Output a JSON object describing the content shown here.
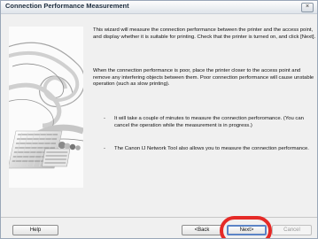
{
  "window": {
    "title": "Connection Performance Measurement",
    "close_label": "×"
  },
  "body": {
    "p1": "This wizard will measure the connection performance between the printer and the access point, and display whether it is suitable for printing. Check that the printer is turned on, and click [Next].",
    "p2": "When the connection performance is poor, place the printer closer to the access point and remove any interfering objects between them. Poor connection performance will cause unstable operation (such as slow printing).",
    "bullet": "-",
    "b1": "It will take a couple of minutes to measure the connection perforomance. (You can cancel the operation while the measurement is in progress.)",
    "b2": "The Canon IJ Network Tool also allows you to measure the connection performance."
  },
  "buttons": {
    "help": "Help",
    "back": "<Back",
    "next": "Next>",
    "cancel": "Cancel"
  },
  "colors": {
    "accent": "#5b84c6",
    "highlight": "#e52a27"
  }
}
